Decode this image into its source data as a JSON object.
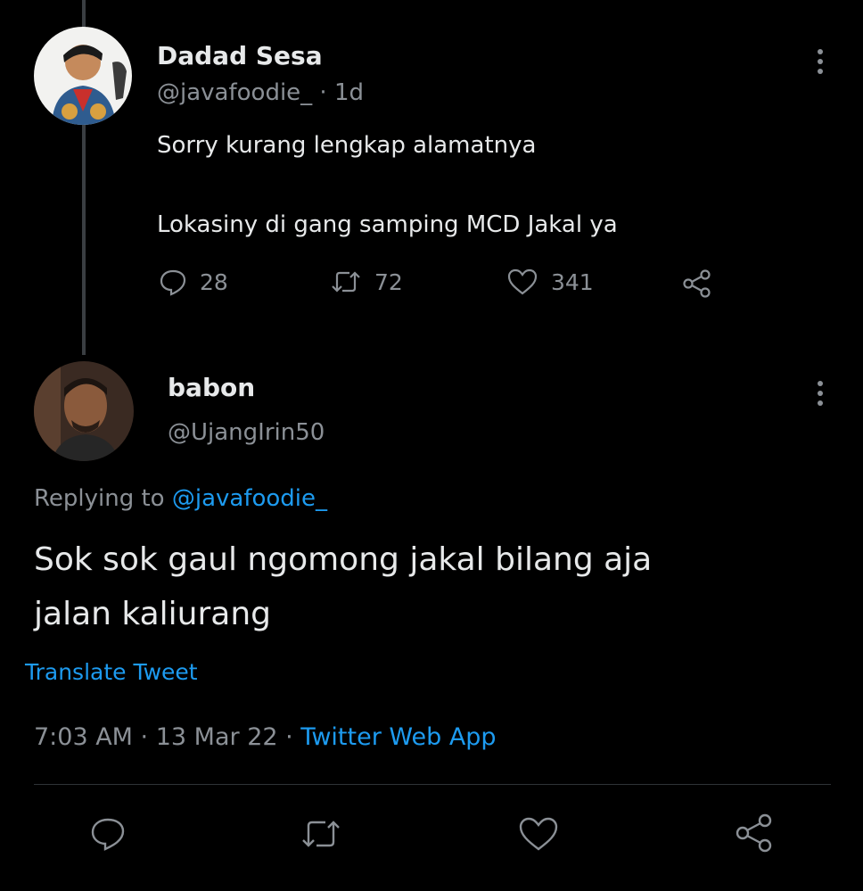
{
  "tweet1": {
    "author_name": "Dadad Sesa",
    "handle_and_time": "@javafoodie_ · 1d",
    "text_line1": "Sorry kurang lengkap alamatnya",
    "text_line2": "Lokasiny di gang samping MCD Jakal ya",
    "reply_count": "28",
    "retweet_count": "72",
    "like_count": "341"
  },
  "tweet2": {
    "author_name": "babon",
    "handle": "@UjangIrin50",
    "replying_prefix": "Replying to ",
    "replying_handle": "@javafoodie_",
    "text_line1": "Sok sok gaul ngomong jakal bilang aja",
    "text_line2": "jalan kaliurang",
    "translate_label": "Translate Tweet",
    "timestamp": "7:03 AM · 13 Mar 22 · ",
    "source": "Twitter Web App"
  },
  "icons": {
    "reply": "reply-icon",
    "retweet": "retweet-icon",
    "like": "like-icon",
    "share": "share-icon",
    "more": "more-vertical-icon"
  },
  "colors": {
    "background": "#000000",
    "text": "#e7e9ea",
    "muted": "#8b9096",
    "link": "#1d9bf0"
  }
}
